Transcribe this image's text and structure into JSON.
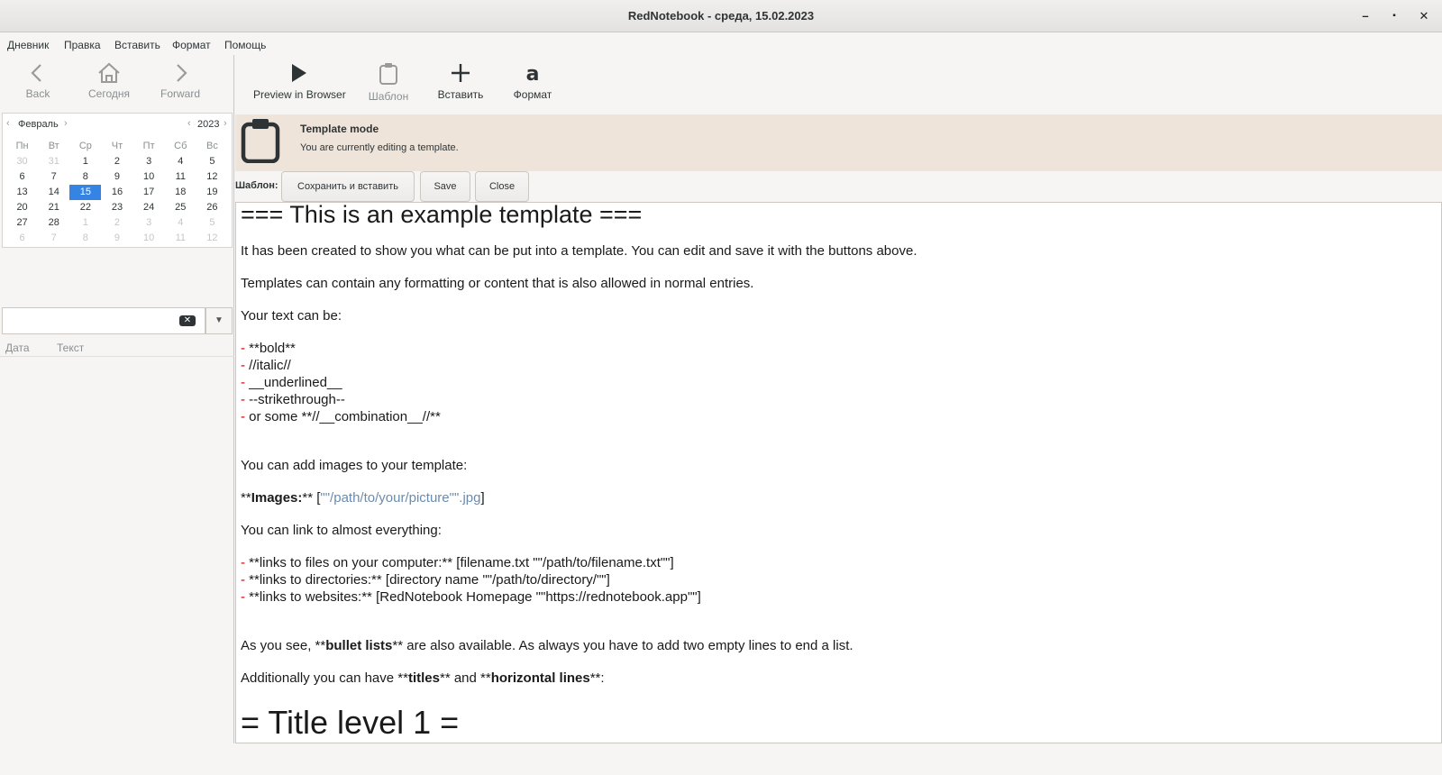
{
  "window": {
    "title": "RedNotebook - среда, 15.02.2023",
    "minimize": "–",
    "maximize": "▪",
    "close": "✕"
  },
  "menu": [
    "Дневник",
    "Правка",
    "Вставить",
    "Формат",
    "Помощь"
  ],
  "nav": {
    "back": "Back",
    "today": "Сегодня",
    "forward": "Forward"
  },
  "calendar": {
    "month": "Февраль",
    "year": "2023",
    "weekdays": [
      "Пн",
      "Вт",
      "Ср",
      "Чт",
      "Пт",
      "Сб",
      "Вс"
    ],
    "weeks": [
      [
        "30",
        "31",
        "1",
        "2",
        "3",
        "4",
        "5"
      ],
      [
        "6",
        "7",
        "8",
        "9",
        "10",
        "11",
        "12"
      ],
      [
        "13",
        "14",
        "15",
        "16",
        "17",
        "18",
        "19"
      ],
      [
        "20",
        "21",
        "22",
        "23",
        "24",
        "25",
        "26"
      ],
      [
        "27",
        "28",
        "1",
        "2",
        "3",
        "4",
        "5"
      ],
      [
        "6",
        "7",
        "8",
        "9",
        "10",
        "11",
        "12"
      ]
    ],
    "selected": "15"
  },
  "search": {
    "placeholder": ""
  },
  "entries": {
    "col_date": "Дата",
    "col_text": "Текст"
  },
  "toolbar": {
    "preview": "Preview in Browser",
    "template": "Шаблон",
    "insert": "Вставить",
    "format": "Формат"
  },
  "banner": {
    "title": "Template mode",
    "subtitle": "You are currently editing a template."
  },
  "template_bar": {
    "label": "Шаблон:",
    "save_insert": "Сохранить и вставить",
    "save": "Save",
    "close": "Close"
  },
  "editor": {
    "heading": "=== This is an example template ===",
    "p1": "It has been created to show you what can be put into a template. You can edit and save it with the buttons above.",
    "p2": "Templates can contain any formatting or content that is also allowed in normal entries.",
    "p3": "Your text can be:",
    "dash": "-",
    "f1": " **bold**",
    "f2": " //italic//",
    "f3": " __underlined__",
    "f4": " --strikethrough--",
    "f5": " or some **//__combination__//**",
    "p4": "You can add images to your template:",
    "img_pre": "**",
    "img_bold": "Images:",
    "img_mid": "** [",
    "img_link": "\"\"/path/to/your/picture\"\".jpg",
    "img_end": "]",
    "p5": "You can link to almost everything:",
    "l1": " **links to files on your computer:** [filename.txt \"\"/path/to/filename.txt\"\"]",
    "l2": " **links to directories:** [directory name \"\"/path/to/directory/\"\"]",
    "l3": " **links to websites:** [RedNotebook Homepage \"\"https://rednotebook.app\"\"]",
    "p6_a": "As you see, **",
    "p6_b": "bullet lists",
    "p6_c": "** are also available. As always you have to add two empty lines to end a list.",
    "p7_a": "Additionally you can have **",
    "p7_b": "titles",
    "p7_c": "** and **",
    "p7_d": "horizontal lines",
    "p7_e": "**:",
    "title1": "= Title level 1 ="
  }
}
